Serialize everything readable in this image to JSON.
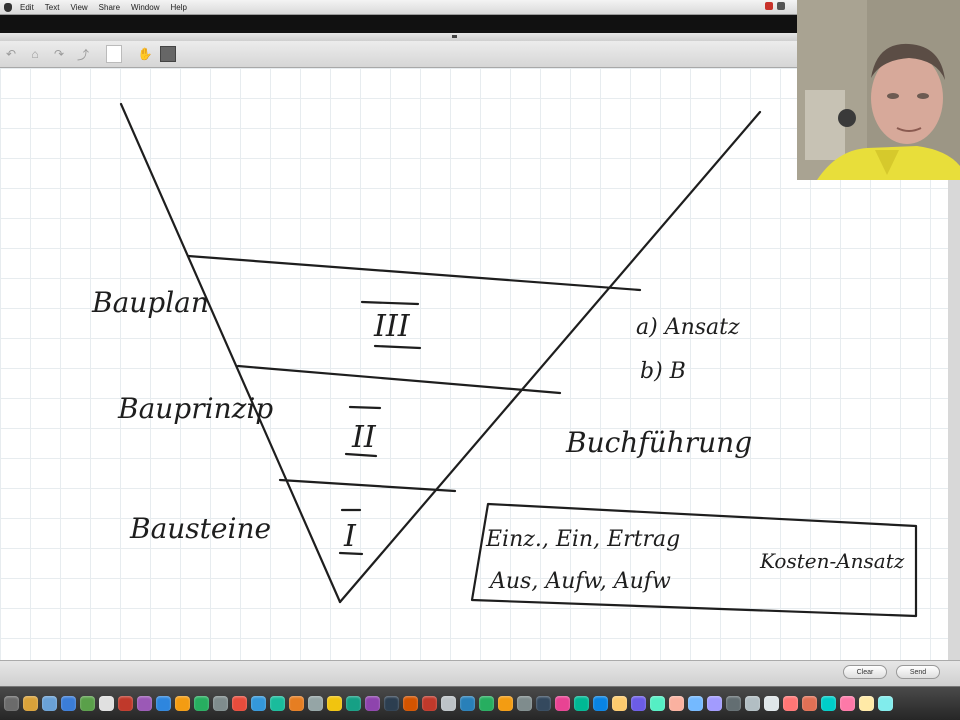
{
  "menubar": {
    "items": [
      "Edit",
      "Text",
      "View",
      "Share",
      "Window",
      "Help"
    ]
  },
  "toolbar": {
    "tools": [
      {
        "name": "undo-icon",
        "glyph": "↶"
      },
      {
        "name": "shape-icon",
        "glyph": "⌂"
      },
      {
        "name": "redo-icon",
        "glyph": "↷"
      },
      {
        "name": "arrow-icon",
        "glyph": "⤴"
      }
    ]
  },
  "whiteboard": {
    "roman_levels": [
      "III",
      "II",
      "I"
    ],
    "left_labels": [
      "Bauplan",
      "Bauprinzip",
      "Bausteine"
    ],
    "right_notes": [
      "a) Ansatz",
      "b) B",
      "Buchführung"
    ],
    "box_lines": [
      "Einz., Ein, Ertrag",
      "Aus, Aufw, Aufw"
    ],
    "box_side": "Kosten-Ansatz",
    "ink_color": "#1e1e1e"
  },
  "footer": {
    "clear_label": "Clear",
    "send_label": "Send"
  },
  "dock": {
    "colors": [
      "#6b6b6b",
      "#d9a23a",
      "#6aa1d6",
      "#3b7dd8",
      "#5aa04a",
      "#e0e0e0",
      "#c0392b",
      "#9b59b6",
      "#2e86de",
      "#f39c12",
      "#27ae60",
      "#7f8c8d",
      "#e74c3c",
      "#3498db",
      "#1abc9c",
      "#e67e22",
      "#95a5a6",
      "#f1c40f",
      "#16a085",
      "#8e44ad",
      "#2c3e50",
      "#d35400",
      "#c0392b",
      "#bdc3c7",
      "#2980b9",
      "#27ae60",
      "#f39c12",
      "#7f8c8d",
      "#34495e",
      "#e84393",
      "#00b894",
      "#0984e3",
      "#fdcb6e",
      "#6c5ce7",
      "#55efc4",
      "#fab1a0",
      "#74b9ff",
      "#a29bfe",
      "#636e72",
      "#b2bec3",
      "#dfe6e9",
      "#ff7675",
      "#e17055",
      "#00cec9",
      "#fd79a8",
      "#ffeaa7",
      "#81ecec"
    ]
  }
}
